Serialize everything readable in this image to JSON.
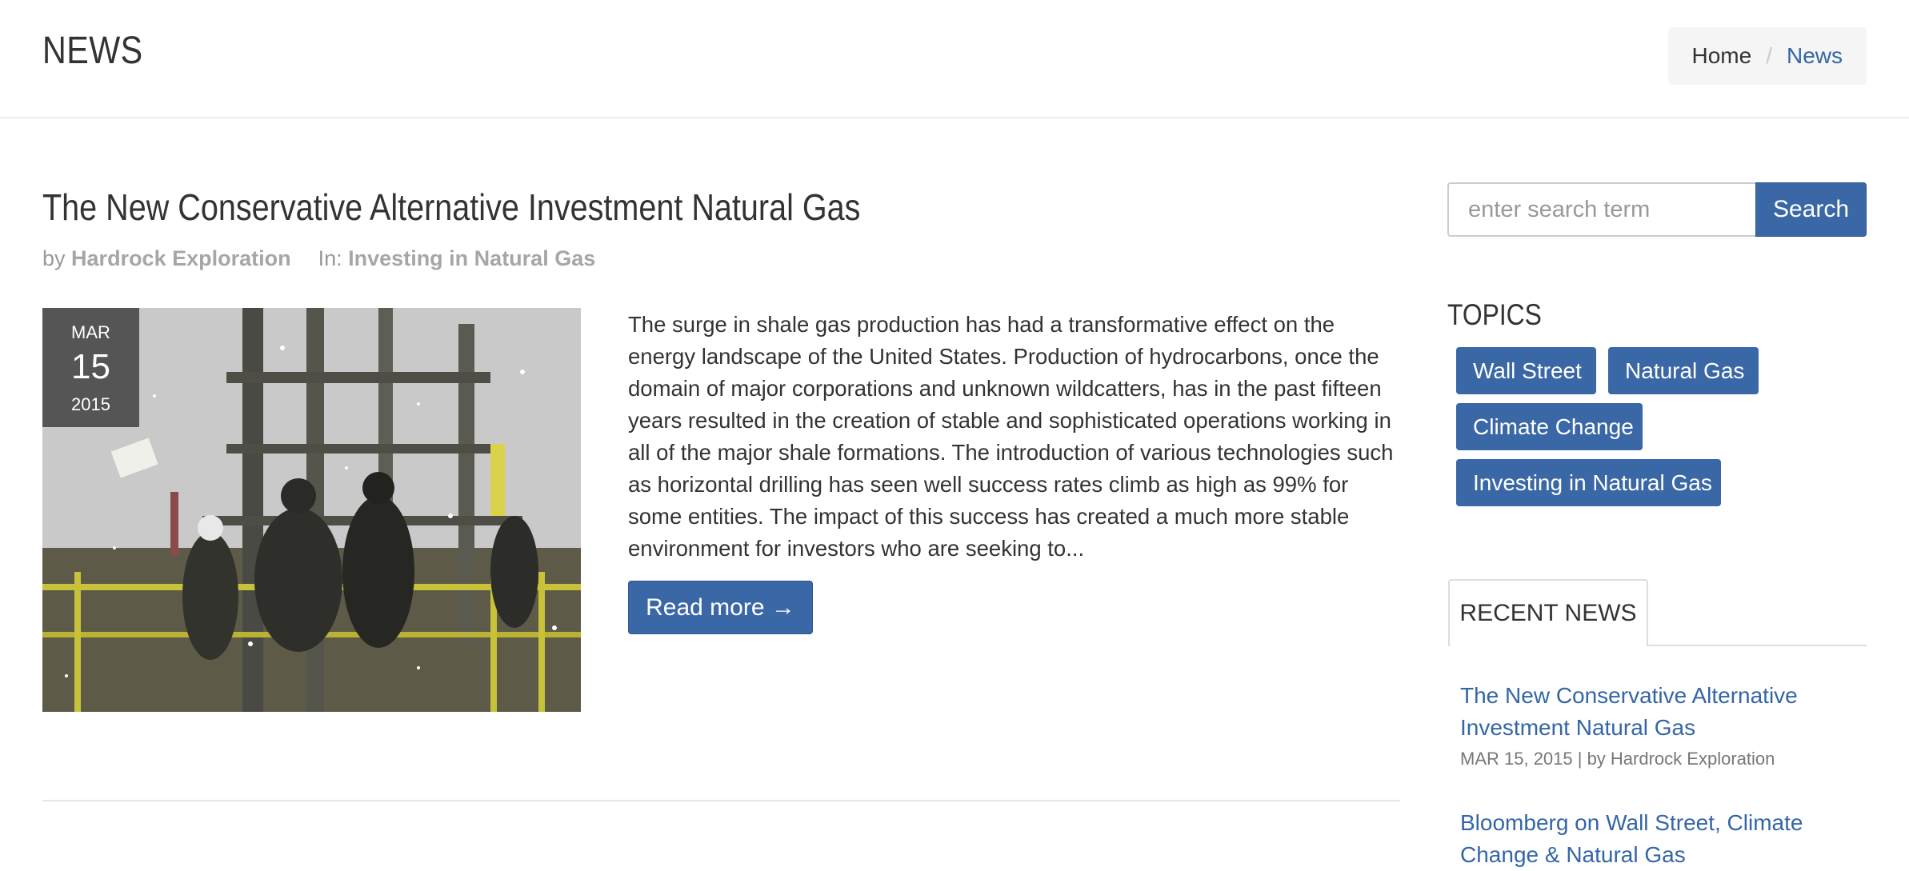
{
  "header": {
    "title": "NEWS",
    "breadcrumb": {
      "home": "Home",
      "separator": "/",
      "current": "News"
    }
  },
  "post": {
    "title": "The New Conservative Alternative Investment Natural Gas",
    "meta": {
      "by_label": "by",
      "author": "Hardrock Exploration",
      "in_label": "In:",
      "category": "Investing in Natural Gas"
    },
    "date": {
      "month": "MAR",
      "day": "15",
      "year": "2015"
    },
    "excerpt": "The surge in shale gas production has had a transformative effect on the energy landscape of the United States. Production of hydrocarbons, once the domain of major corporations and unknown wildcatters, has in the past fifteen years resulted in the creation of stable and sophisticated operations working in all of the major shale formations. The introduction of various technologies such as horizontal drilling has seen well success rates climb as high as 99% for some entities. The impact of this success has created a much more stable environment for investors who are seeking to...",
    "read_more_label": "Read more →"
  },
  "sidebar": {
    "search": {
      "placeholder": "enter search term",
      "button_label": "Search"
    },
    "topics": {
      "heading": "TOPICS",
      "tags": [
        "Wall Street",
        "Natural Gas",
        "Climate Change",
        "Investing in Natural Gas"
      ]
    },
    "recent": {
      "tab_label": "RECENT NEWS",
      "items": [
        {
          "title": "The New Conservative Alternative Investment Natural Gas",
          "meta": "MAR 15, 2015 | by Hardrock Exploration"
        },
        {
          "title": "Bloomberg on Wall Street, Climate Change & Natural Gas",
          "meta": ""
        }
      ]
    }
  },
  "colors": {
    "accent": "#3a67a6",
    "link": "#3466a5",
    "date_badge": "#555555"
  },
  "icons": {
    "read_more_arrow": "right-arrow-icon"
  }
}
